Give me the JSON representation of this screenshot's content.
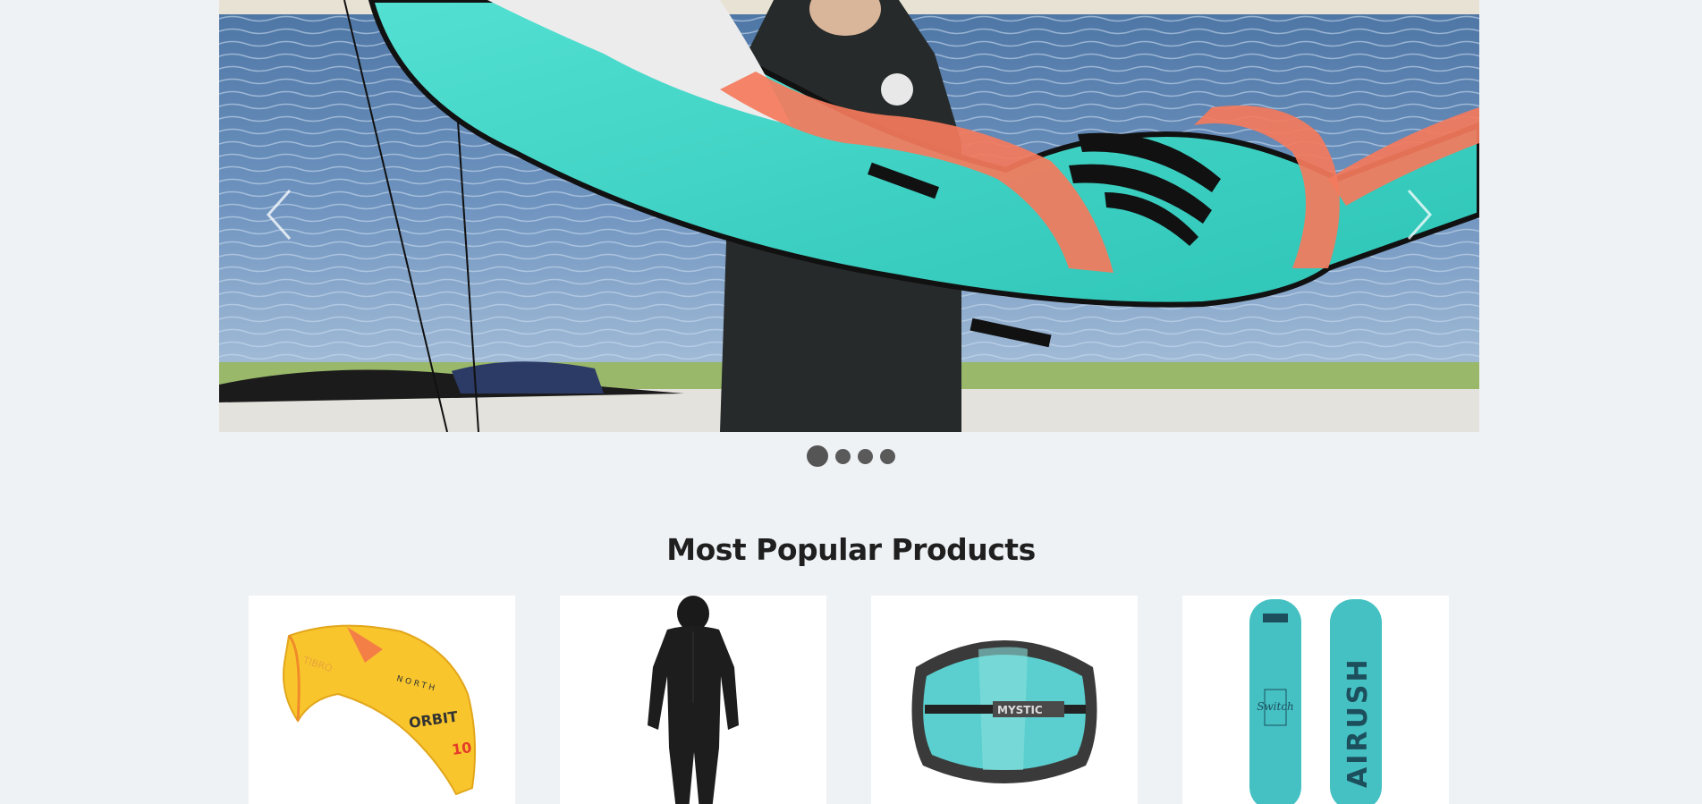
{
  "hero_carousel": {
    "image_alt": "Kitesurfer holding a turquoise and orange kite by the sea",
    "prev_icon": "chevron-left-icon",
    "next_icon": "chevron-right-icon",
    "slide_count": 4,
    "active_slide": 1
  },
  "popular_section": {
    "title": "Most Popular Products",
    "products": [
      {
        "image_alt": "North Orbit 10 kite",
        "brand_text": "NORTH",
        "model_text": "ORBIT",
        "size_text": "10",
        "sub_text": "TIBRO"
      },
      {
        "image_alt": "Black full wetsuit"
      },
      {
        "image_alt": "Mystic waist harness",
        "brand_text": "MYSTIC"
      },
      {
        "image_alt": "Airush Switch kiteboard",
        "brand_text": "AIRUSH",
        "model_text": "Switch"
      }
    ]
  },
  "colors": {
    "page_background": "#eff2f5",
    "kite_turquoise": "#3fd6c8",
    "kite_orange": "#f26d4e",
    "dot": "#555555"
  }
}
